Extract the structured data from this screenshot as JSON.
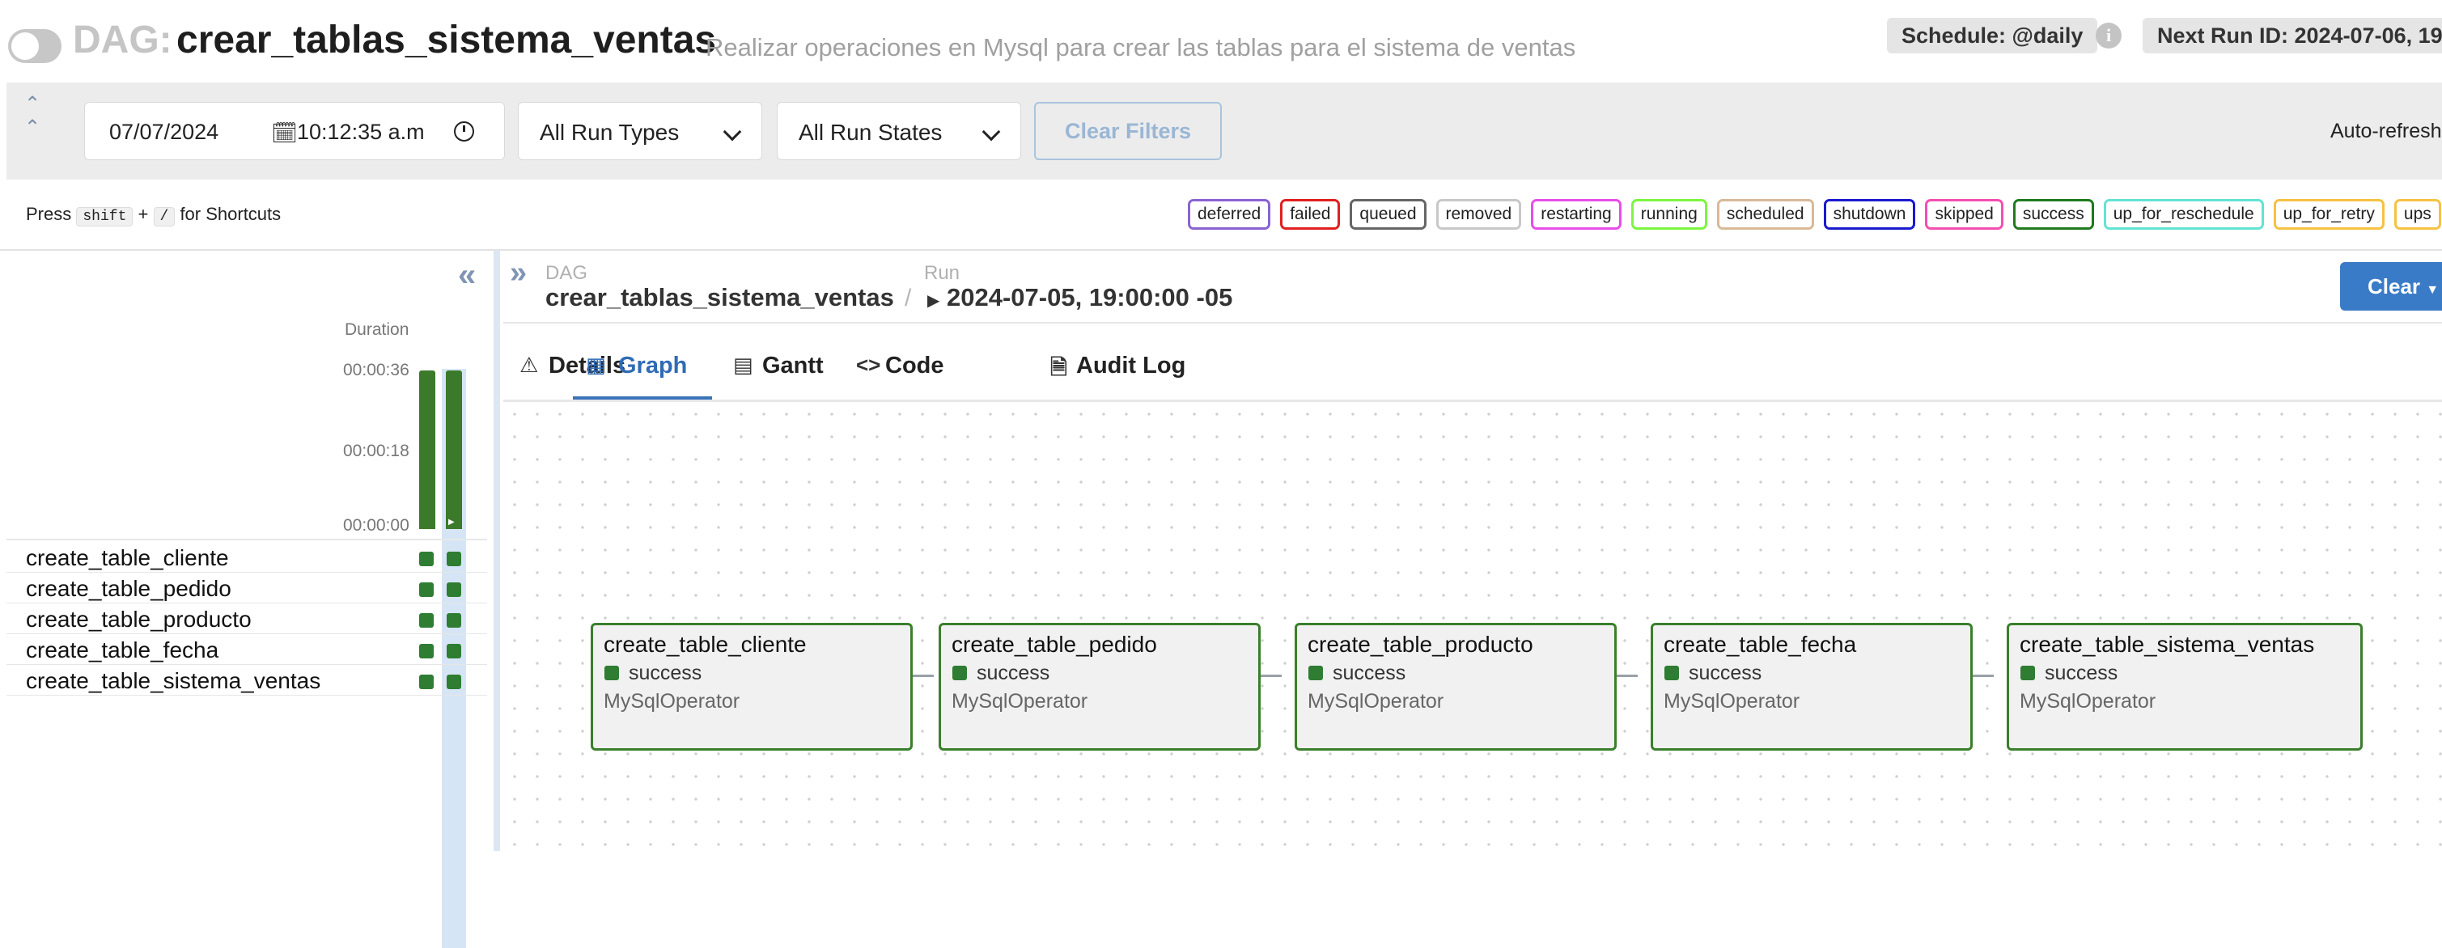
{
  "header": {
    "dag_prefix": "DAG:",
    "dag_id": "crear_tablas_sistema_ventas",
    "description": "Realizar operaciones en Mysql para crear las tablas para el sistema de ventas",
    "schedule": "Schedule: @daily",
    "next_run": "Next Run ID: 2024-07-06, 19"
  },
  "filters": {
    "date": "07/07/2024",
    "time": "10:12:35  a.m",
    "run_types": "All Run Types",
    "run_states": "All Run States",
    "clear_filters": "Clear Filters",
    "auto_refresh": "Auto-refresh"
  },
  "shortcuts": {
    "press": "Press",
    "key1": "shift",
    "plus": "+",
    "key2": "/",
    "suffix": "for Shortcuts"
  },
  "legend": [
    {
      "label": "deferred",
      "color": "#8a63d2"
    },
    {
      "label": "failed",
      "color": "#e02020"
    },
    {
      "label": "queued",
      "color": "#666666"
    },
    {
      "label": "removed",
      "color": "#c8c8c8"
    },
    {
      "label": "restarting",
      "color": "#e84ee8"
    },
    {
      "label": "running",
      "color": "#7cf542"
    },
    {
      "label": "scheduled",
      "color": "#d8b999"
    },
    {
      "label": "shutdown",
      "color": "#1a1acf"
    },
    {
      "label": "skipped",
      "color": "#f44fb0"
    },
    {
      "label": "success",
      "color": "#1f7a1f"
    },
    {
      "label": "up_for_reschedule",
      "color": "#63e3d3"
    },
    {
      "label": "up_for_retry",
      "color": "#f5c242"
    },
    {
      "label": "ups",
      "color": "#f5c242"
    }
  ],
  "grid": {
    "duration_label": "Duration",
    "ticks": [
      "00:00:36",
      "00:00:18",
      "00:00:00"
    ],
    "tasks": [
      "create_table_cliente",
      "create_table_pedido",
      "create_table_producto",
      "create_table_fecha",
      "create_table_sistema_ventas"
    ]
  },
  "breadcrumb": {
    "dag_label": "DAG",
    "dag_value": "crear_tablas_sistema_ventas",
    "sep": "/",
    "run_label": "Run",
    "run_value": "2024-07-05, 19:00:00 -05"
  },
  "clear_button": "Clear",
  "tabs": {
    "details": "Details",
    "graph": "Graph",
    "gantt": "Gantt",
    "code": "Code",
    "audit_log": "Audit Log"
  },
  "graph": {
    "nodes": [
      {
        "name": "create_table_cliente",
        "state": "success",
        "operator": "MySqlOperator"
      },
      {
        "name": "create_table_pedido",
        "state": "success",
        "operator": "MySqlOperator"
      },
      {
        "name": "create_table_producto",
        "state": "success",
        "operator": "MySqlOperator"
      },
      {
        "name": "create_table_fecha",
        "state": "success",
        "operator": "MySqlOperator"
      },
      {
        "name": "create_table_sistema_ventas",
        "state": "success",
        "operator": "MySqlOperator"
      }
    ]
  }
}
